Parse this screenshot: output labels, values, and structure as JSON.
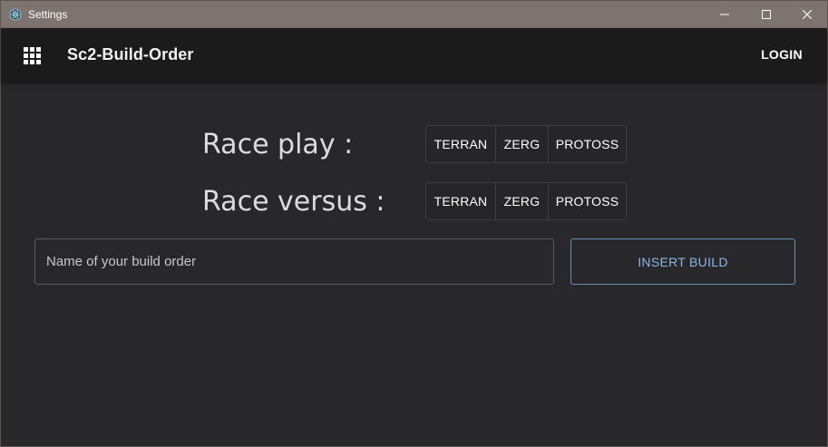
{
  "window": {
    "title": "Settings"
  },
  "appbar": {
    "menu_icon": "apps-grid-icon",
    "title": "Sc2-Build-Order",
    "login_label": "LOGIN"
  },
  "race_play": {
    "label": "Race play :",
    "options": [
      "TERRAN",
      "ZERG",
      "PROTOSS"
    ]
  },
  "race_versus": {
    "label": "Race versus :",
    "options": [
      "TERRAN",
      "ZERG",
      "PROTOSS"
    ]
  },
  "build_form": {
    "name_placeholder": "Name of your build order",
    "name_value": "",
    "insert_label": "INSERT BUILD"
  },
  "colors": {
    "titlebar": "#7d7470",
    "appbar": "#1b1b1c",
    "background": "#28282a",
    "accent": "#8ab8e6"
  }
}
